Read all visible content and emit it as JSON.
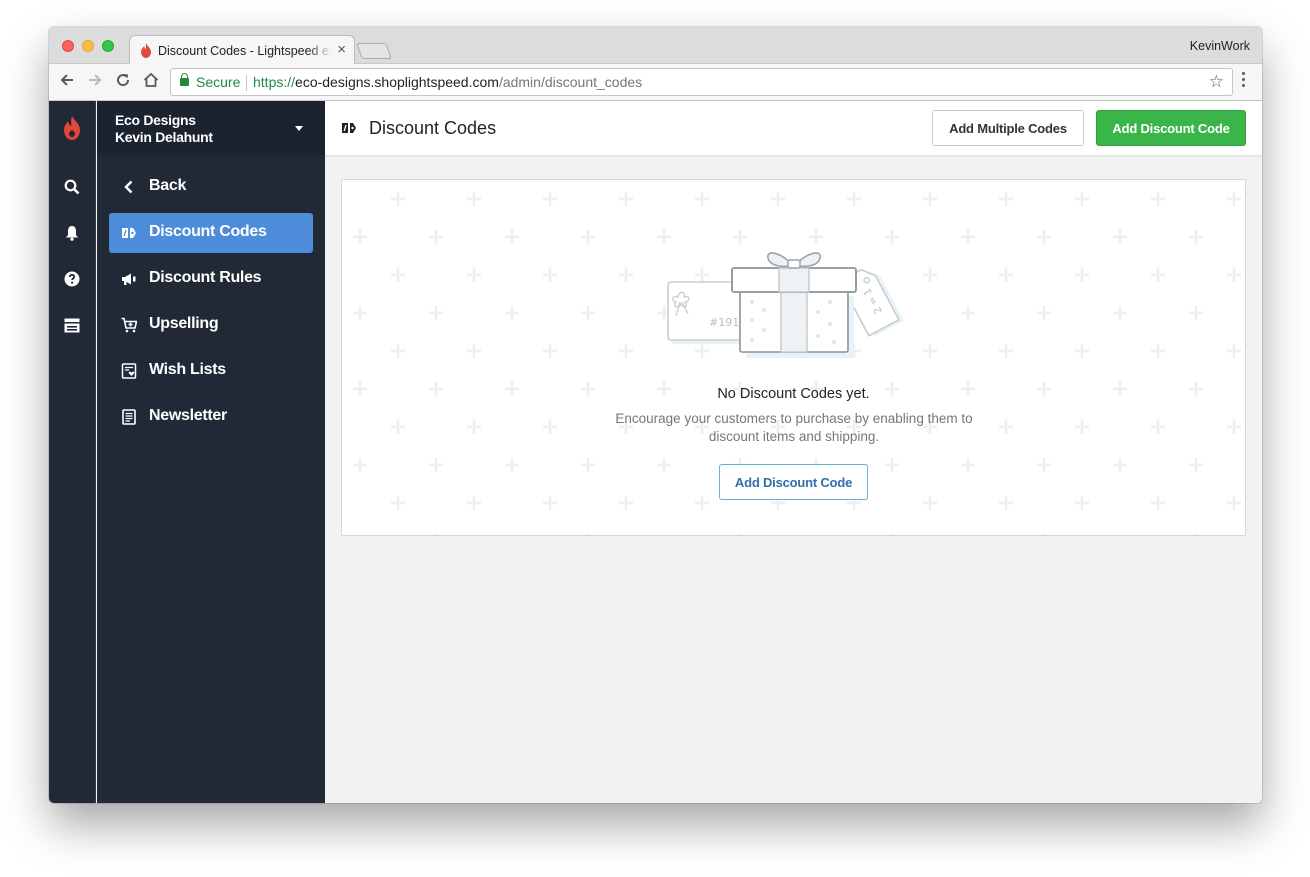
{
  "browser": {
    "tab_title": "Discount Codes - Lightspeed eCom",
    "profile": "KevinWork",
    "secure_label": "Secure",
    "url_scheme": "https://",
    "url_host": "eco-designs.shoplightspeed.com",
    "url_path": "/admin/discount_codes"
  },
  "store": {
    "name": "Eco Designs",
    "user": "Kevin Delahunt"
  },
  "sidebar": {
    "back_label": "Back",
    "items": [
      {
        "label": "Discount Codes",
        "icon": "discount-code-icon",
        "active": true
      },
      {
        "label": "Discount Rules",
        "icon": "megaphone-icon",
        "active": false
      },
      {
        "label": "Upselling",
        "icon": "cart-plus-icon",
        "active": false
      },
      {
        "label": "Wish Lists",
        "icon": "wishlist-icon",
        "active": false
      },
      {
        "label": "Newsletter",
        "icon": "newsletter-icon",
        "active": false
      }
    ]
  },
  "rail": {
    "icons": [
      "search-icon",
      "bell-icon",
      "help-icon",
      "storefront-icon"
    ]
  },
  "page": {
    "title": "Discount Codes",
    "add_multiple_label": "Add Multiple Codes",
    "add_code_label": "Add Discount Code"
  },
  "empty_state": {
    "title": "No Discount Codes yet.",
    "description": "Encourage your customers to purchase by enabling them to discount items and shipping.",
    "button_label": "Add Discount Code",
    "illustration_text_card": "#191",
    "illustration_text_tag": "2 = 1"
  },
  "colors": {
    "sidebar_bg": "#212936",
    "active_item": "#4c8cd9",
    "primary_button": "#3ab54a",
    "brand_red": "#e2463c"
  }
}
